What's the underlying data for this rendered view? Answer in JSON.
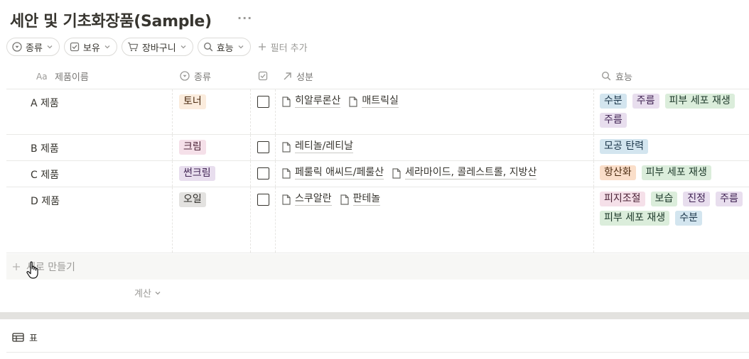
{
  "page": {
    "title": "세안 및 기초화장품(Sample)",
    "more": "···"
  },
  "filters": [
    {
      "label": "종류",
      "icon": "select-icon"
    },
    {
      "label": "보유",
      "icon": "checkbox-icon"
    },
    {
      "label": "장바구니",
      "icon": "cart-icon"
    },
    {
      "label": "효능",
      "icon": "search-icon"
    }
  ],
  "add_filter_label": "필터 추가",
  "columns": {
    "name": "제품이름",
    "type": "종류",
    "ingredients": "성분",
    "effects": "효능"
  },
  "rows": [
    {
      "name": "A 제품",
      "type": {
        "label": "토너",
        "bg": "#fbecdd",
        "fg": "#49290e"
      },
      "owned": false,
      "ingredients": [
        "히알루론산",
        "매트릭실"
      ],
      "effects": [
        {
          "label": "수분",
          "bg": "#d3e5ef",
          "fg": "#183347"
        },
        {
          "label": "주름",
          "bg": "#e8deee",
          "fg": "#412454"
        },
        {
          "label": "피부 세포 재생",
          "bg": "#dbeddb",
          "fg": "#1c3829"
        },
        {
          "label": "주름",
          "bg": "#e8deee",
          "fg": "#412454"
        }
      ]
    },
    {
      "name": "B 제품",
      "type": {
        "label": "크림",
        "bg": "#f5e0e9",
        "fg": "#4c2337"
      },
      "owned": false,
      "ingredients": [
        "레티놀/레티날"
      ],
      "effects": [
        {
          "label": "모공 탄력",
          "bg": "#d3e5ef",
          "fg": "#183347"
        }
      ]
    },
    {
      "name": "C 제품",
      "type": {
        "label": "썬크림",
        "bg": "#e8deee",
        "fg": "#412454"
      },
      "owned": false,
      "ingredients": [
        "페룰릭 애씨드/페룰산",
        "세라마이드, 콜레스트롤, 지방산"
      ],
      "effects": [
        {
          "label": "항산화",
          "bg": "#fadec9",
          "fg": "#49290e"
        },
        {
          "label": "피부 세포 재생",
          "bg": "#dbeddb",
          "fg": "#1c3829"
        }
      ]
    },
    {
      "name": "D 제품",
      "type": {
        "label": "오일",
        "bg": "#e3e2e0",
        "fg": "#32302c"
      },
      "owned": false,
      "ingredients": [
        "스쿠알란",
        "판테놀"
      ],
      "effects": [
        {
          "label": "피지조절",
          "bg": "#f5e0e9",
          "fg": "#4c2337"
        },
        {
          "label": "보습",
          "bg": "#dbeddb",
          "fg": "#1c3829"
        },
        {
          "label": "진정",
          "bg": "#e8deee",
          "fg": "#412454"
        },
        {
          "label": "주름",
          "bg": "#e8deee",
          "fg": "#412454"
        },
        {
          "label": "피부 세포 재생",
          "bg": "#dbeddb",
          "fg": "#1c3829"
        },
        {
          "label": "수분",
          "bg": "#d3e5ef",
          "fg": "#183347"
        }
      ]
    }
  ],
  "new_row_label": "새로 만들기",
  "calc_label": "계산",
  "view_label": "표"
}
